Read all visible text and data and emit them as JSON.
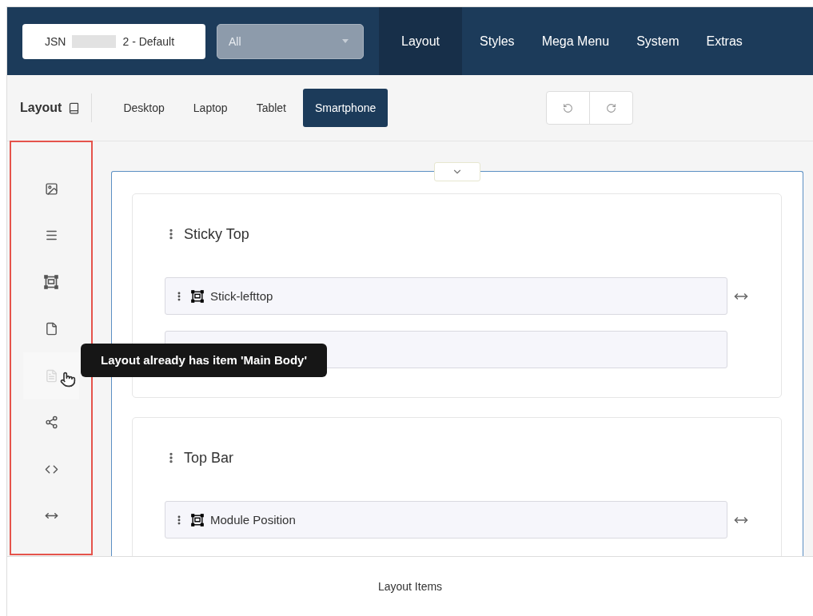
{
  "topbar": {
    "template": {
      "prefix": "JSN",
      "suffix": "2 - Default"
    },
    "filter": {
      "value": "All"
    },
    "nav": [
      {
        "label": "Layout",
        "selected": true
      },
      {
        "label": "Styles",
        "selected": false
      },
      {
        "label": "Mega Menu",
        "selected": false
      },
      {
        "label": "System",
        "selected": false
      },
      {
        "label": "Extras",
        "selected": false
      }
    ]
  },
  "toolbar": {
    "title": "Layout",
    "devices": [
      {
        "label": "Desktop",
        "selected": false
      },
      {
        "label": "Laptop",
        "selected": false
      },
      {
        "label": "Tablet",
        "selected": false
      },
      {
        "label": "Smartphone",
        "selected": true
      }
    ]
  },
  "sidebar": {
    "items": [
      {
        "disabled": false
      },
      {
        "disabled": false
      },
      {
        "disabled": false
      },
      {
        "disabled": false
      },
      {
        "disabled": true
      },
      {
        "disabled": false
      },
      {
        "disabled": false
      },
      {
        "disabled": false
      }
    ]
  },
  "tooltip": "Layout already has item 'Main Body'",
  "sections": [
    {
      "title": "Sticky Top",
      "items": [
        {
          "label": "Stick-lefttop",
          "resizable": true
        },
        {
          "resizable": false
        }
      ]
    },
    {
      "title": "Top Bar",
      "items": [
        {
          "label": "Module Position",
          "resizable": true
        }
      ]
    }
  ],
  "caption": "Layout Items"
}
